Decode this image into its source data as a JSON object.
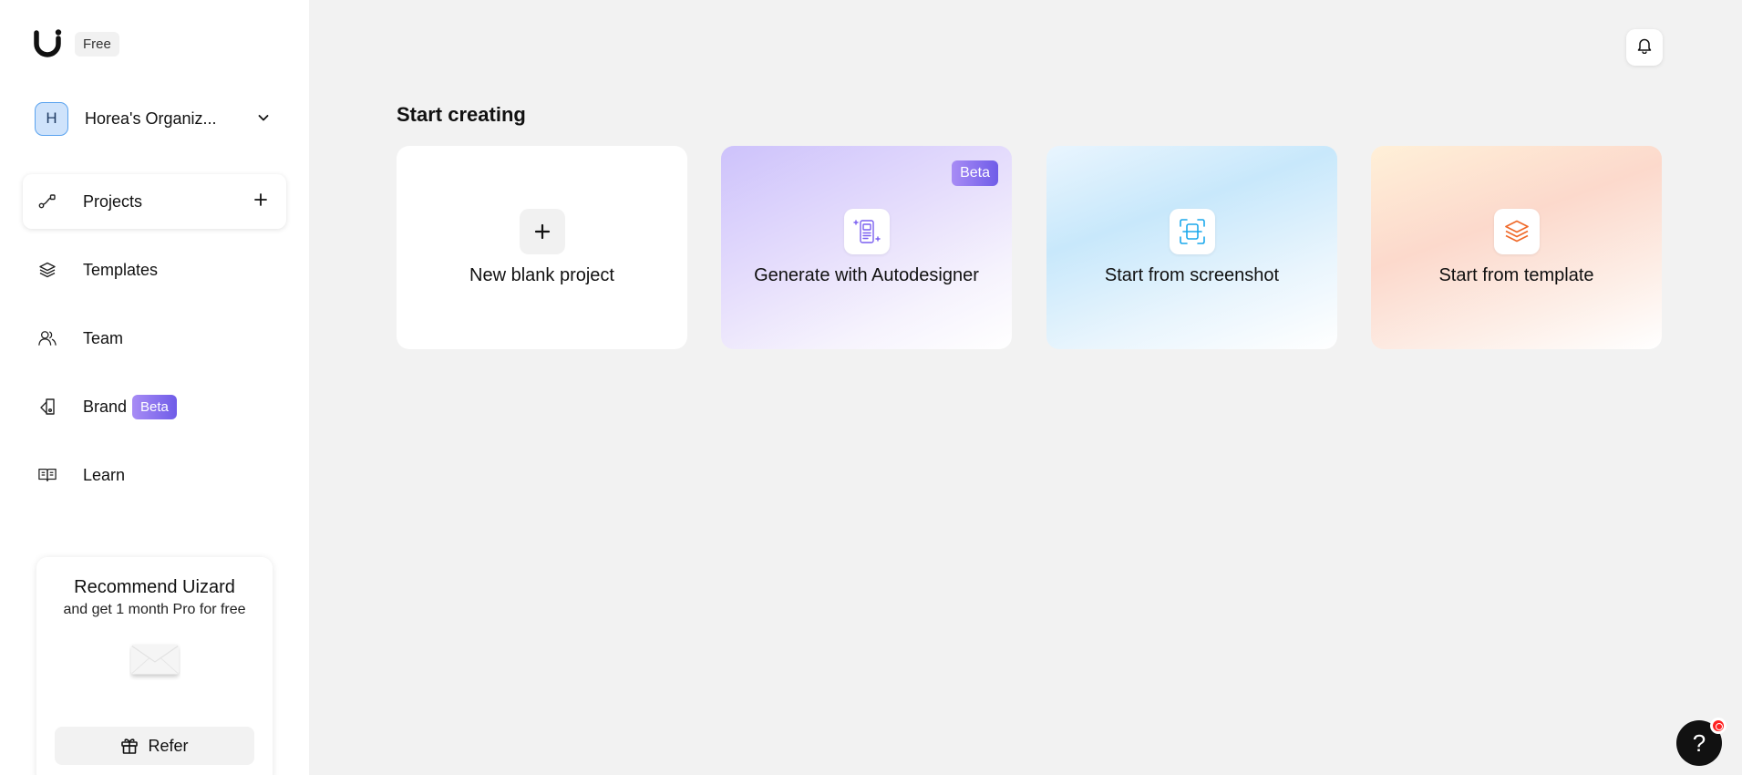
{
  "app": {
    "plan_badge": "Free",
    "colors": {
      "accent": "#7a5ff0",
      "bg": "#f2f2f2"
    }
  },
  "org": {
    "initial": "H",
    "name": "Horea's Organiz..."
  },
  "sidebar": {
    "items": [
      {
        "label": "Projects",
        "icon": "projects-icon",
        "active": true
      },
      {
        "label": "Templates",
        "icon": "layers-icon"
      },
      {
        "label": "Team",
        "icon": "team-icon"
      },
      {
        "label": "Brand",
        "icon": "brand-icon",
        "badge": "Beta"
      },
      {
        "label": "Learn",
        "icon": "book-icon"
      }
    ]
  },
  "promo": {
    "title": "Recommend Uizard",
    "subtitle": "and get 1 month Pro for free",
    "button": "Refer"
  },
  "main": {
    "section_title": "Start creating",
    "cards": [
      {
        "label": "New blank project"
      },
      {
        "label": "Generate with Autodesigner",
        "badge": "Beta"
      },
      {
        "label": "Start from screenshot"
      },
      {
        "label": "Start from template"
      }
    ]
  },
  "help": {
    "label": "?"
  }
}
